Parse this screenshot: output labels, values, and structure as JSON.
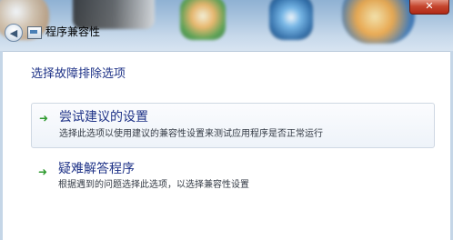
{
  "window": {
    "title": "程序兼容性",
    "close_label": "✕",
    "back_glyph": "◀"
  },
  "main": {
    "heading": "选择故障排除选项",
    "options": [
      {
        "title": "尝试建议的设置",
        "description": "选择此选项以使用建议的兼容性设置来测试应用程序是否正常运行",
        "icon": "green-arrow-icon",
        "arrow_glyph": "➜"
      },
      {
        "title": "疑难解答程序",
        "description": "根据遇到的问题选择此选项，以选择兼容性设置",
        "icon": "green-arrow-icon",
        "arrow_glyph": "➜"
      }
    ]
  },
  "colors": {
    "link_blue": "#1e3287",
    "arrow_green": "#2e9a2e"
  }
}
